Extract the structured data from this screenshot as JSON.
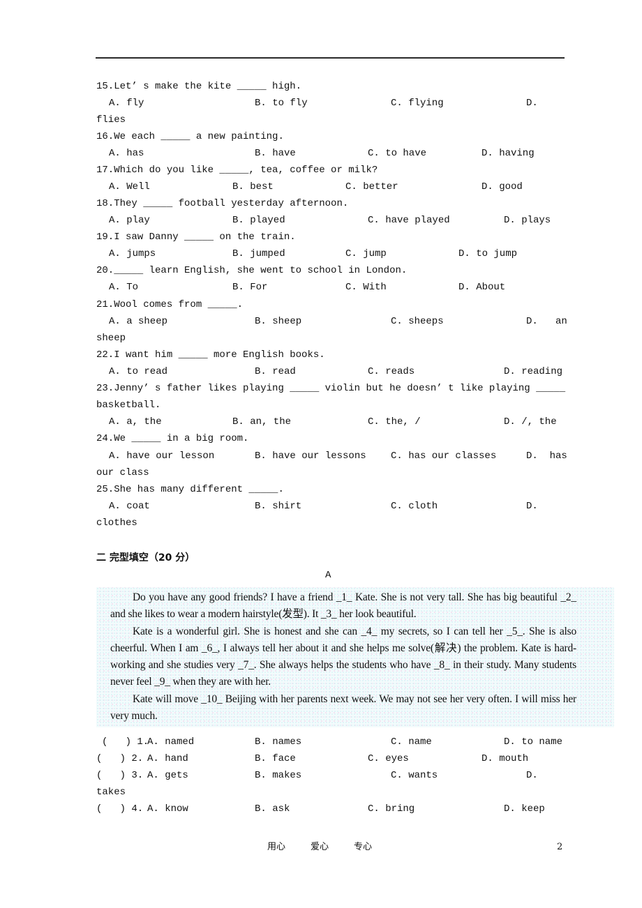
{
  "questions": [
    {
      "stem": "15.Let’ s make the kite _____ high.",
      "options": [
        "A. fly",
        "B. to fly",
        "C. flying",
        "D."
      ],
      "wrap": "flies"
    },
    {
      "stem": "16.We each _____ a new painting.",
      "options": [
        "A. has",
        "B. have",
        "C. to have",
        "D. having"
      ]
    },
    {
      "stem": "17.Which do you like _____, tea, coffee or milk?",
      "options": [
        "A. Well",
        "B. best",
        "C. better",
        "D. good"
      ]
    },
    {
      "stem": "18.They _____ football yesterday afternoon.",
      "options": [
        "A. play",
        "B. played",
        "C. have played",
        "D. plays"
      ]
    },
    {
      "stem": "19.I saw Danny _____ on the train.",
      "options": [
        "A. jumps",
        "B. jumped",
        "C. jump",
        "D. to jump"
      ]
    },
    {
      "stem": "20._____ learn English, she went to school in London.",
      "options": [
        "A. To",
        "B. For",
        "C. With",
        "D. About"
      ]
    },
    {
      "stem": "21.Wool comes from _____.",
      "options": [
        "A. a sheep",
        "B. sheep",
        "C. sheeps",
        "D.   an"
      ],
      "wrap": "sheep"
    },
    {
      "stem": "22.I want him _____ more English books.",
      "options": [
        "A. to read",
        "B. read",
        "C. reads",
        "D. reading"
      ]
    },
    {
      "stem": "23.Jenny’ s father likes playing _____ violin but he doesn’ t like playing _____",
      "stem_wrap": "basketball.",
      "options": [
        "A. a, the",
        "B. an, the",
        "C. the, /",
        "D. /, the"
      ]
    },
    {
      "stem": "24.We _____ in a big room.",
      "options": [
        "A. have our lesson",
        "B. have our lessons",
        "C. has our classes",
        "D.  has"
      ],
      "wrap": "our class"
    },
    {
      "stem": "25.She has many different _____.",
      "options": [
        "A. coat",
        "B. shirt",
        "C. cloth",
        "D."
      ],
      "wrap": "clothes"
    }
  ],
  "section": {
    "heading": "二 完型填空（20 分）",
    "passage_label": "A",
    "paragraphs": [
      "Do you have any good friends? I have a friend _1_ Kate. She is not very tall. She has big beautiful _2_ and she likes to wear a modern hairstyle(发型). It _3_ her look beautiful.",
      "Kate is a wonderful girl. She is honest and she can _4_ my secrets, so I can tell her _5_. She is also cheerful. When I am _6_, I always tell her about it and she helps me solve(解决) the problem. Kate is hard-working and she studies very _7_. She always helps the students who have _8_ in their study. Many students never feel _9_ when they are with her.",
      "Kate will move _10_ Beijing with her parents next week. We may not see her very often. I will miss her very much."
    ],
    "cloze_items": [
      {
        "prefix": "(   ) 1.",
        "options": [
          "A. named",
          "B. names",
          "C. name",
          "D. to name"
        ]
      },
      {
        "prefix": "(   ) 2.",
        "options": [
          "A. hand",
          "B. face",
          "C. eyes",
          "D. mouth"
        ]
      },
      {
        "prefix": "(   ) 3.",
        "options": [
          "A. gets",
          "B. makes",
          "C. wants",
          "D."
        ],
        "wrap": "takes"
      },
      {
        "prefix": "(   ) 4.",
        "options": [
          "A. know",
          "B. ask",
          "C. bring",
          "D. keep"
        ]
      }
    ]
  },
  "footer": {
    "mottos": [
      "用心",
      "爱心",
      "专心"
    ],
    "page_number": "2"
  }
}
